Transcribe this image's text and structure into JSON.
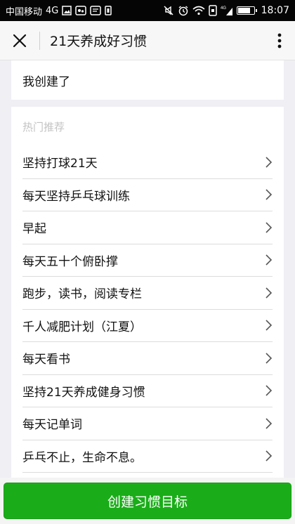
{
  "status_bar": {
    "carrier": "中国移动",
    "network": "4G",
    "network_small": "4G",
    "time": "18:07",
    "battery_level": 0.85,
    "icons": [
      "image-icon",
      "wechat-icon",
      "message-icon",
      "sim-icon",
      "mute-icon",
      "alarm-icon",
      "wifi-icon",
      "phone-icon",
      "signal-icon",
      "battery-icon"
    ]
  },
  "title_bar": {
    "title": "21天养成好习惯",
    "close_icon": "close-icon",
    "more_icon": "more-vertical-icon"
  },
  "created": {
    "label": "我创建了"
  },
  "hot": {
    "header": "热门推荐",
    "items": [
      {
        "label": "坚持打球21天"
      },
      {
        "label": "每天坚持乒乓球训练"
      },
      {
        "label": "早起"
      },
      {
        "label": "每天五十个俯卧撑"
      },
      {
        "label": "跑步，读书，阅读专栏"
      },
      {
        "label": "千人减肥计划（江夏）"
      },
      {
        "label": "每天看书"
      },
      {
        "label": "坚持21天养成健身习惯"
      },
      {
        "label": "每天记单词"
      },
      {
        "label": "乒乓不止，生命不息。"
      }
    ]
  },
  "bottom": {
    "button_label": "创建习惯目标"
  },
  "colors": {
    "primary": "#1aad19",
    "background": "#efeff4",
    "header_hint": "#c3c3c3"
  }
}
